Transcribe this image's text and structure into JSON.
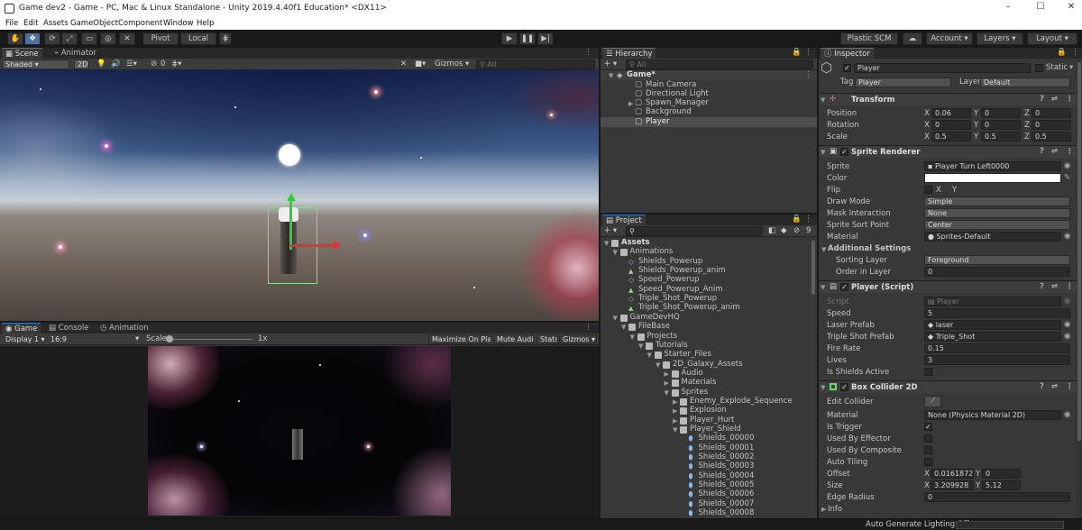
{
  "window": {
    "title": "Game dev2 - Game - PC, Mac & Linux Standalone - Unity 2019.4.40f1 Education* <DX11>"
  },
  "menu": [
    "File",
    "Edit",
    "Assets",
    "GameObject",
    "Component",
    "Window",
    "Help"
  ],
  "toolbar": {
    "pivot": "Pivot",
    "local": "Local",
    "plastic": "Plastic SCM",
    "account": "Account",
    "layers": "Layers",
    "layout": "Layout"
  },
  "scene": {
    "tabs": [
      "Scene",
      "Animator"
    ],
    "shading": "Shaded",
    "mode2d": "2D",
    "fx_count": "0",
    "gizmos": "Gizmos",
    "search_placeholder": "All"
  },
  "game": {
    "tabs": [
      "Game",
      "Console",
      "Animation"
    ],
    "display": "Display 1",
    "aspect": "16:9",
    "scale_label": "Scale",
    "scale_value": "1x",
    "maximize": "Maximize On Play",
    "mute": "Mute Audio",
    "stats": "Stats",
    "gizmos": "Gizmos"
  },
  "hierarchy": {
    "tab": "Hierarchy",
    "search_placeholder": "All",
    "scene": "Game*",
    "items": [
      "Main Camera",
      "Directional Light",
      "Spawn_Manager",
      "Background",
      "Player"
    ]
  },
  "project": {
    "tab": "Project",
    "count": "9",
    "tree": [
      {
        "label": "Assets",
        "depth": 0,
        "open": true,
        "kind": "folder"
      },
      {
        "label": "Animations",
        "depth": 1,
        "open": true,
        "kind": "folder"
      },
      {
        "label": "Shields_Powerup",
        "depth": 2,
        "kind": "clip"
      },
      {
        "label": "Shields_Powerup_anim",
        "depth": 2,
        "kind": "anim"
      },
      {
        "label": "Speed_Powerup",
        "depth": 2,
        "kind": "clip"
      },
      {
        "label": "Speed_Powerup_Anim",
        "depth": 2,
        "kind": "anim"
      },
      {
        "label": "Triple_Shot_Powerup",
        "depth": 2,
        "kind": "clip"
      },
      {
        "label": "Triple_Shot_Powerup_anim",
        "depth": 2,
        "kind": "anim"
      },
      {
        "label": "GameDevHQ",
        "depth": 1,
        "open": true,
        "kind": "folder"
      },
      {
        "label": "FileBase",
        "depth": 2,
        "open": true,
        "kind": "folder"
      },
      {
        "label": "Projects",
        "depth": 3,
        "open": true,
        "kind": "folder"
      },
      {
        "label": "Tutorials",
        "depth": 4,
        "open": true,
        "kind": "folder"
      },
      {
        "label": "Starter_Files",
        "depth": 5,
        "open": true,
        "kind": "folder"
      },
      {
        "label": "2D_Galaxy_Assets",
        "depth": 6,
        "open": true,
        "kind": "folder"
      },
      {
        "label": "Audio",
        "depth": 7,
        "open": false,
        "kind": "folder"
      },
      {
        "label": "Materials",
        "depth": 7,
        "open": false,
        "kind": "folder"
      },
      {
        "label": "Sprites",
        "depth": 7,
        "open": true,
        "kind": "folder"
      },
      {
        "label": "Enemy_Explode_Sequence",
        "depth": 8,
        "open": false,
        "kind": "folder"
      },
      {
        "label": "Explosion",
        "depth": 8,
        "open": false,
        "kind": "folder"
      },
      {
        "label": "Player_Hurt",
        "depth": 8,
        "open": false,
        "kind": "folder"
      },
      {
        "label": "Player_Shield",
        "depth": 8,
        "open": true,
        "kind": "folder"
      },
      {
        "label": "Shields_00000",
        "depth": 9,
        "kind": "sprite"
      },
      {
        "label": "Shields_00001",
        "depth": 9,
        "kind": "sprite"
      },
      {
        "label": "Shields_00002",
        "depth": 9,
        "kind": "sprite"
      },
      {
        "label": "Shields_00003",
        "depth": 9,
        "kind": "sprite"
      },
      {
        "label": "Shields_00004",
        "depth": 9,
        "kind": "sprite"
      },
      {
        "label": "Shields_00005",
        "depth": 9,
        "kind": "sprite"
      },
      {
        "label": "Shields_00006",
        "depth": 9,
        "kind": "sprite"
      },
      {
        "label": "Shields_00007",
        "depth": 9,
        "kind": "sprite"
      },
      {
        "label": "Shields_00008",
        "depth": 9,
        "kind": "sprite"
      }
    ]
  },
  "inspector": {
    "tab": "Inspector",
    "name": "Player",
    "static": "Static",
    "tag_label": "Tag",
    "tag": "Player",
    "layer_label": "Layer",
    "layer": "Default",
    "transform": {
      "title": "Transform",
      "position_label": "Position",
      "position": [
        "0.06",
        "0",
        "0"
      ],
      "rotation_label": "Rotation",
      "rotation": [
        "0",
        "0",
        "0"
      ],
      "scale_label": "Scale",
      "scale": [
        "0.5",
        "0.5",
        "0.5"
      ],
      "axes": [
        "X",
        "Y",
        "Z"
      ]
    },
    "sprite_renderer": {
      "title": "Sprite Renderer",
      "sprite_label": "Sprite",
      "sprite": "Player Turn Left0000",
      "color_label": "Color",
      "flip_label": "Flip",
      "flip_x": "X",
      "flip_y": "Y",
      "draw_mode_label": "Draw Mode",
      "draw_mode": "Simple",
      "mask_label": "Mask Interaction",
      "mask": "None",
      "sort_point_label": "Sprite Sort Point",
      "sort_point": "Center",
      "material_label": "Material",
      "material": "Sprites-Default",
      "additional": "Additional Settings",
      "sorting_layer_label": "Sorting Layer",
      "sorting_layer": "Foreground",
      "order_label": "Order in Layer",
      "order": "0"
    },
    "script": {
      "title": "Player (Script)",
      "script_label": "Script",
      "script": "Player",
      "speed_label": "Speed",
      "speed": "5",
      "laser_label": "Laser Prefab",
      "laser": "laser",
      "triple_label": "Triple Shot Prefab",
      "triple": "Triple_Shot",
      "fire_label": "Fire Rate",
      "fire": "0.15",
      "lives_label": "Lives",
      "lives": "3",
      "shields_label": "Is Shields Active"
    },
    "collider": {
      "title": "Box Collider 2D",
      "edit_label": "Edit Collider",
      "material_label": "Material",
      "material": "None (Physics Material 2D)",
      "trigger_label": "Is Trigger",
      "effector_label": "Used By Effector",
      "composite_label": "Used By Composite",
      "tiling_label": "Auto Tiling",
      "offset_label": "Offset",
      "offset_x": "0.01618725",
      "offset_y": "0",
      "size_label": "Size",
      "size_x": "3.209928",
      "size_y": "5.12",
      "radius_label": "Edge Radius",
      "radius": "0",
      "info": "Info"
    }
  },
  "status": {
    "text": "Auto Generate Lighting Off"
  }
}
